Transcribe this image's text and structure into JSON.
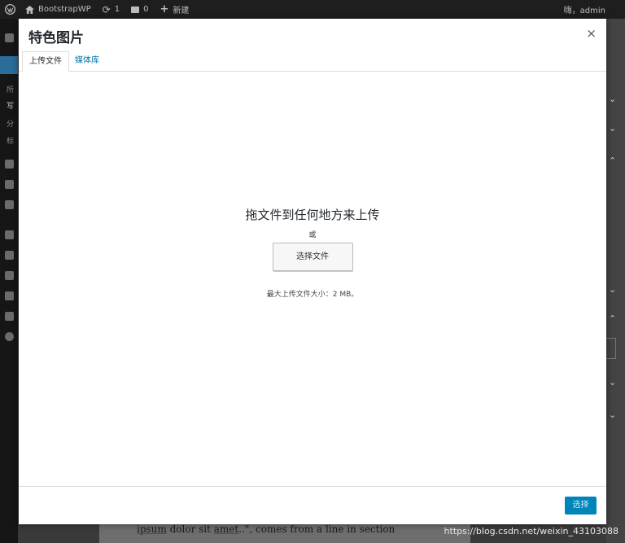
{
  "adminbar": {
    "site_name": "BootstrapWP",
    "updates_count": "1",
    "comments_count": "0",
    "new_label": "新建",
    "greeting": "嗨，admin"
  },
  "sidebar": {
    "labels": [
      "所",
      "写",
      "分",
      "标"
    ]
  },
  "modal": {
    "title": "特色图片",
    "close_symbol": "×",
    "tabs": [
      {
        "label": "上传文件",
        "active": true
      },
      {
        "label": "媒体库",
        "active": false
      }
    ],
    "upload": {
      "heading": "拖文件到任何地方来上传",
      "or_text": "或",
      "select_button": "选择文件",
      "max_size": "最大上传文件大小：2 MB。"
    },
    "choose_button": "选择"
  },
  "background_text": {
    "line1_a": "ipsum",
    "line1_b": " dolor sit ",
    "line1_c": "amet",
    "line1_d": "..\", comes from a line in section"
  },
  "watermark": "https://blog.csdn.net/weixin_43103088",
  "colors": {
    "accent": "#0085ba",
    "link": "#0073aa",
    "adminbar": "#1e1e1e"
  }
}
